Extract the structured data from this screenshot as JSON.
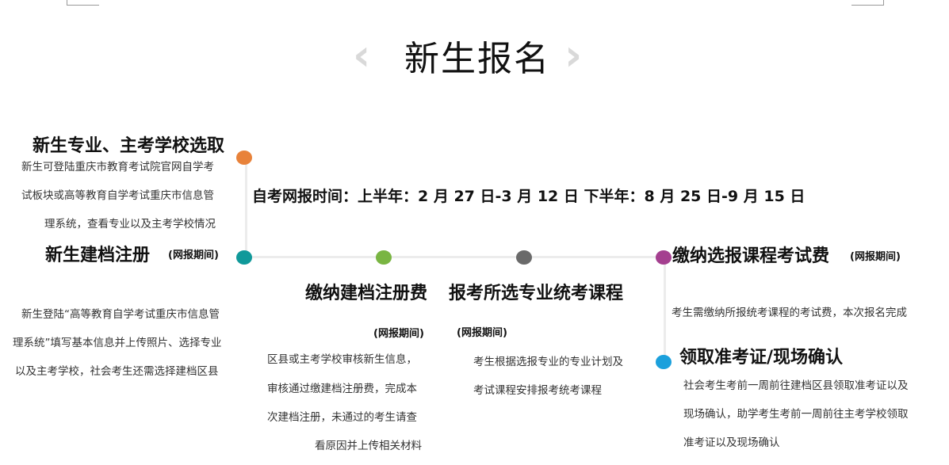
{
  "title": "新生报名",
  "nav": {
    "prev": "‹",
    "next": "›"
  },
  "time_notice": "自考网报时间：上半年：2 月 27 日-3 月 12 日  下半年：8 月 25 日-9 月 15 日",
  "tag_online": "(网报期间)",
  "step1": {
    "title": "新生专业、主考学校选取",
    "lines": [
      "新生可登陆重庆市教育考试院官网自学考",
      "试板块或高等教育自学考试重庆市信息管",
      "理系统，查看专业以及主考学校情况"
    ]
  },
  "step2": {
    "title": "新生建档注册",
    "lines": [
      "新生登陆“高等教育自学考试重庆市信息管",
      "理系统”填写基本信息并上传照片、选择专业",
      "以及主考学校，社会考生还需选择建档区县"
    ]
  },
  "step3": {
    "title": "缴纳建档注册费",
    "lines": [
      "区县或主考学校审核新生信息，",
      "审核通过缴建档注册费，完成本",
      "次建档注册，未通过的考生请查",
      "看原因并上传相关材料"
    ]
  },
  "step4": {
    "title": "报考所选专业统考课程",
    "lines": [
      "考生根据选报专业的专业计划及",
      "考试课程安排报考统考课程"
    ]
  },
  "step5": {
    "title": "缴纳选报课程考试费",
    "lines": [
      "考生需缴纳所报统考课程的考试费，本次报名完成"
    ]
  },
  "step6": {
    "title": "领取准考证/现场确认",
    "lines": [
      "社会考生考前一周前往建档区县领取准考证以及",
      "现场确认，助学考生考前一周前往主考学校领取",
      "准考证以及现场确认"
    ]
  },
  "colors": {
    "orange": "#e8823a",
    "teal": "#10999a",
    "green": "#79b542",
    "gray": "#6a6a6a",
    "purple": "#a43f8f",
    "blue": "#1ba0dc"
  }
}
